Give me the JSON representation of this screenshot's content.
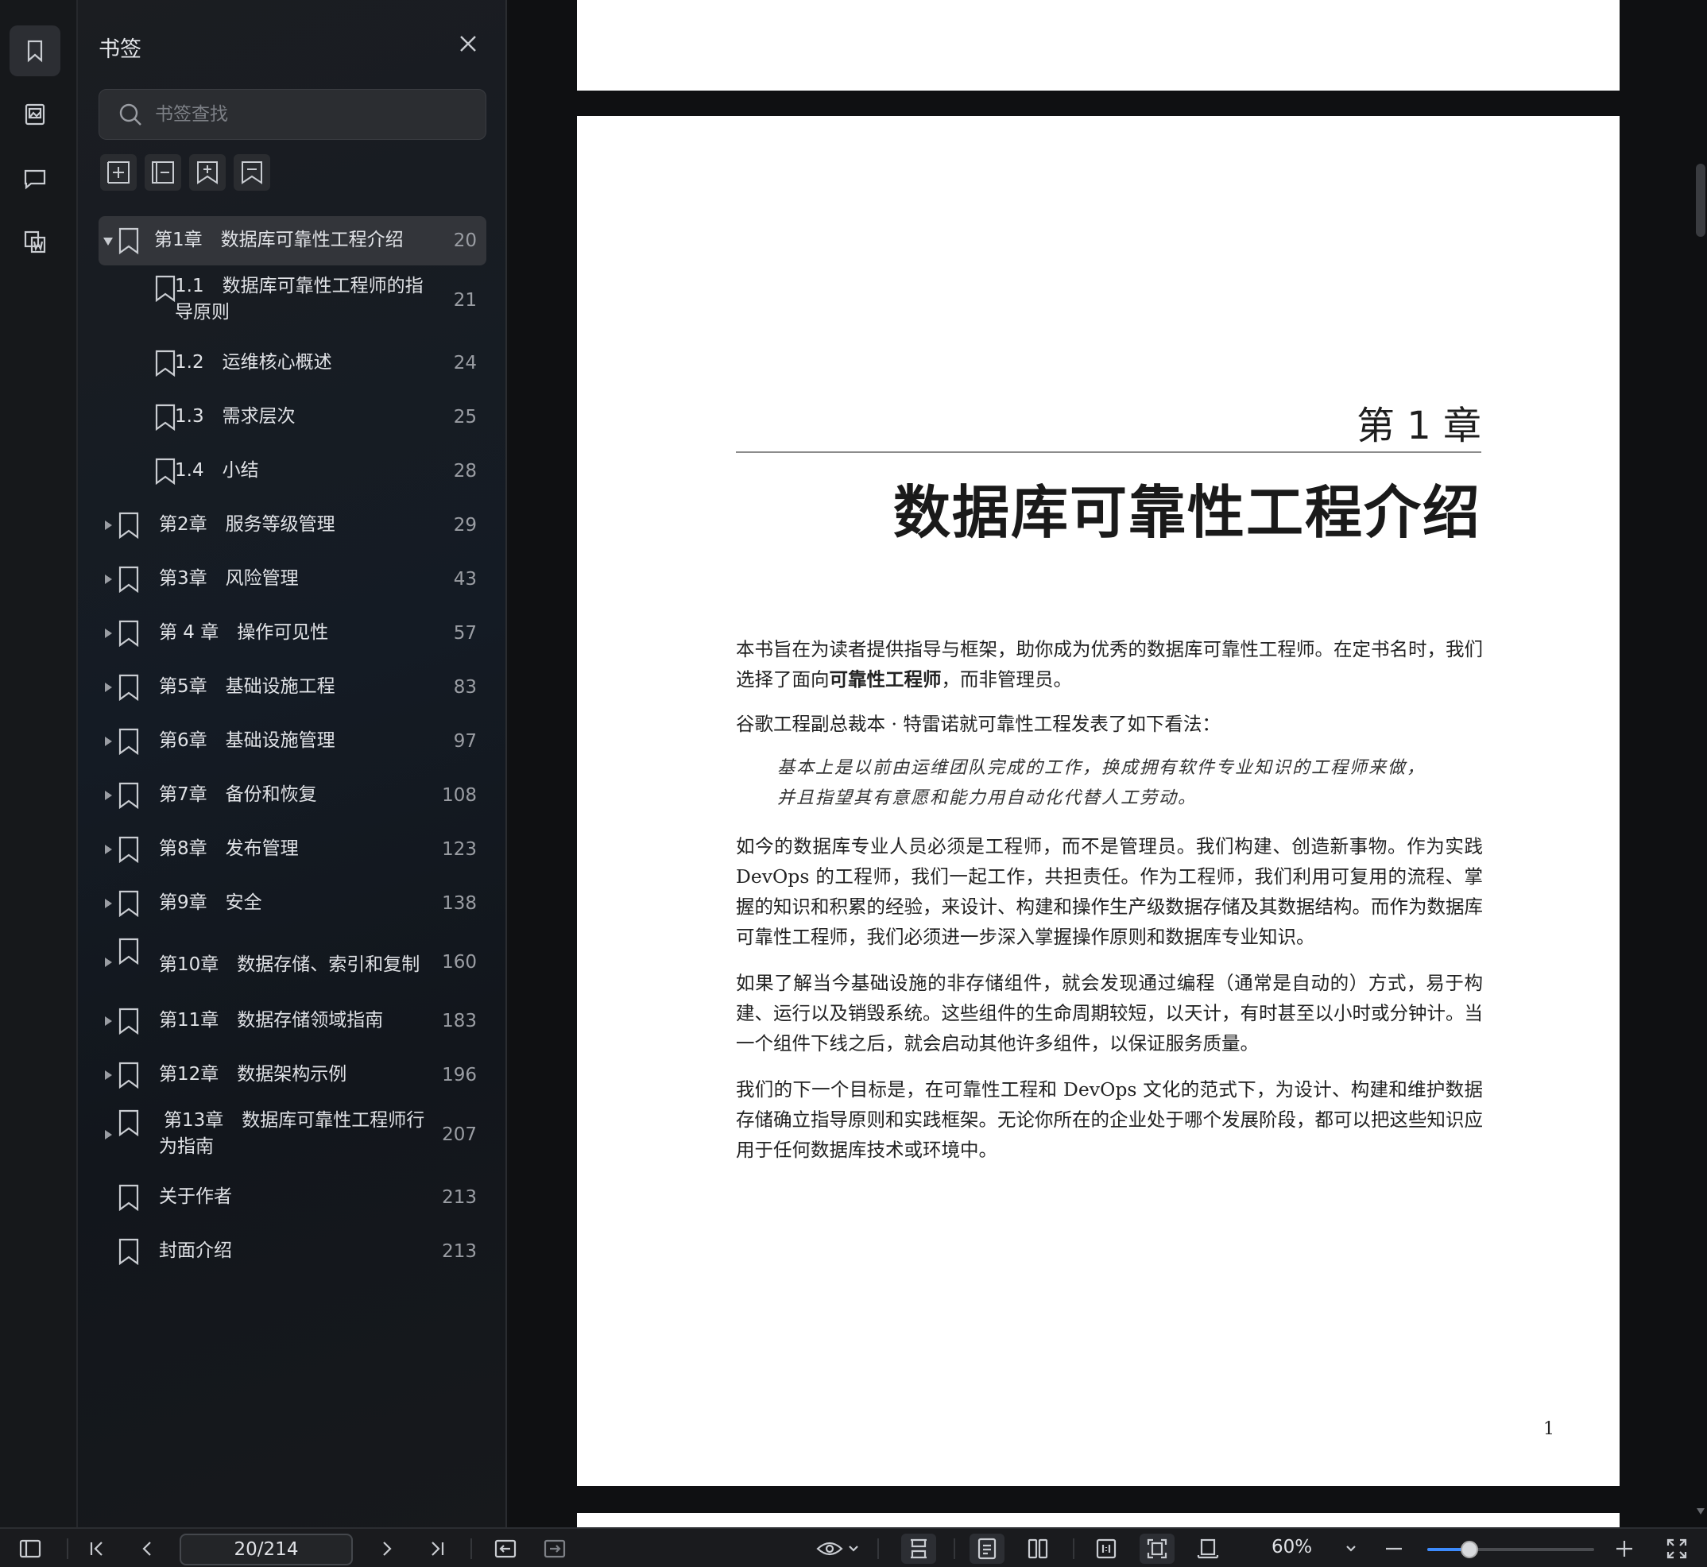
{
  "panel": {
    "title": "书签",
    "search_placeholder": "书签查找"
  },
  "bookmarks": [
    {
      "label": "第1章　数据库可靠性工程介绍",
      "page": "20",
      "level": 0,
      "state": "expanded",
      "selected": true
    },
    {
      "label": "1.1　数据库可靠性工程师的指\n导原则",
      "page": "21",
      "level": 1,
      "state": "none"
    },
    {
      "label": "1.2　运维核心概述",
      "page": "24",
      "level": 1,
      "state": "none"
    },
    {
      "label": "1.3　需求层次",
      "page": "25",
      "level": 1,
      "state": "none"
    },
    {
      "label": "1.4　小结",
      "page": "28",
      "level": 1,
      "state": "none"
    },
    {
      "label": "第2章　服务等级管理",
      "page": "29",
      "level": 0,
      "state": "collapsed"
    },
    {
      "label": "第3章　风险管理",
      "page": "43",
      "level": 0,
      "state": "collapsed"
    },
    {
      "label": "第 4 章　操作可见性",
      "page": "57",
      "level": 0,
      "state": "collapsed"
    },
    {
      "label": "第5章　基础设施工程",
      "page": "83",
      "level": 0,
      "state": "collapsed"
    },
    {
      "label": "第6章　基础设施管理",
      "page": "97",
      "level": 0,
      "state": "collapsed"
    },
    {
      "label": "第7章　备份和恢复",
      "page": "108",
      "level": 0,
      "state": "collapsed"
    },
    {
      "label": "第8章　发布管理",
      "page": "123",
      "level": 0,
      "state": "collapsed"
    },
    {
      "label": "第9章　安全",
      "page": "138",
      "level": 0,
      "state": "collapsed"
    },
    {
      "label": "第10章　数据存储、索引和复制",
      "page": "160",
      "level": 0,
      "state": "collapsed",
      "tall": true
    },
    {
      "label": "第11章　数据存储领域指南",
      "page": "183",
      "level": 0,
      "state": "collapsed"
    },
    {
      "label": "第12章　数据架构示例",
      "page": "196",
      "level": 0,
      "state": "collapsed"
    },
    {
      "label": "第13章　数据库可靠性工程师行\n为指南",
      "page": "207",
      "level": 0,
      "state": "collapsed"
    },
    {
      "label": "关于作者",
      "page": "213",
      "level": 0,
      "state": "none"
    },
    {
      "label": "封面介绍",
      "page": "213",
      "level": 0,
      "state": "none"
    }
  ],
  "document": {
    "chapter_number": "第 1 章",
    "chapter_title": "数据库可靠性工程介绍",
    "p1_a": "本书旨在为读者提供指导与框架，助你成为优秀的数据库可靠性工程师。在定书名时，我们选择了面向",
    "p1_bold": "可靠性工程师",
    "p1_b": "，而非管理员。",
    "p2": "谷歌工程副总裁本 · 特雷诺就可靠性工程发表了如下看法：",
    "quote_1": "基本上是以前由运维团队完成的工作，换成拥有软件专业知识的工程师来做，",
    "quote_2": "并且指望其有意愿和能力用自动化代替人工劳动。",
    "p3": "如今的数据库专业人员必须是工程师，而不是管理员。我们构建、创造新事物。作为实践 DevOps 的工程师，我们一起工作，共担责任。作为工程师，我们利用可复用的流程、掌握的知识和积累的经验，来设计、构建和操作生产级数据存储及其数据结构。而作为数据库可靠性工程师，我们必须进一步深入掌握操作原则和数据库专业知识。",
    "p4": "如果了解当今基础设施的非存储组件，就会发现通过编程（通常是自动的）方式，易于构建、运行以及销毁系统。这些组件的生命周期较短，以天计，有时甚至以小时或分钟计。当一个组件下线之后，就会启动其他许多组件，以保证服务质量。",
    "p5": "我们的下一个目标是，在可靠性工程和 DevOps 文化的范式下，为设计、构建和维护数据存储确立指导原则和实践框架。无论你所在的企业处于哪个发展阶段，都可以把这些知识应用于任何数据库技术或环境中。",
    "page_number": "1"
  },
  "toolbar": {
    "page_indicator": "20/214",
    "zoom_label": "60%",
    "zoom_level_fraction": 0.25,
    "accent_color": "#3d8bfd"
  }
}
